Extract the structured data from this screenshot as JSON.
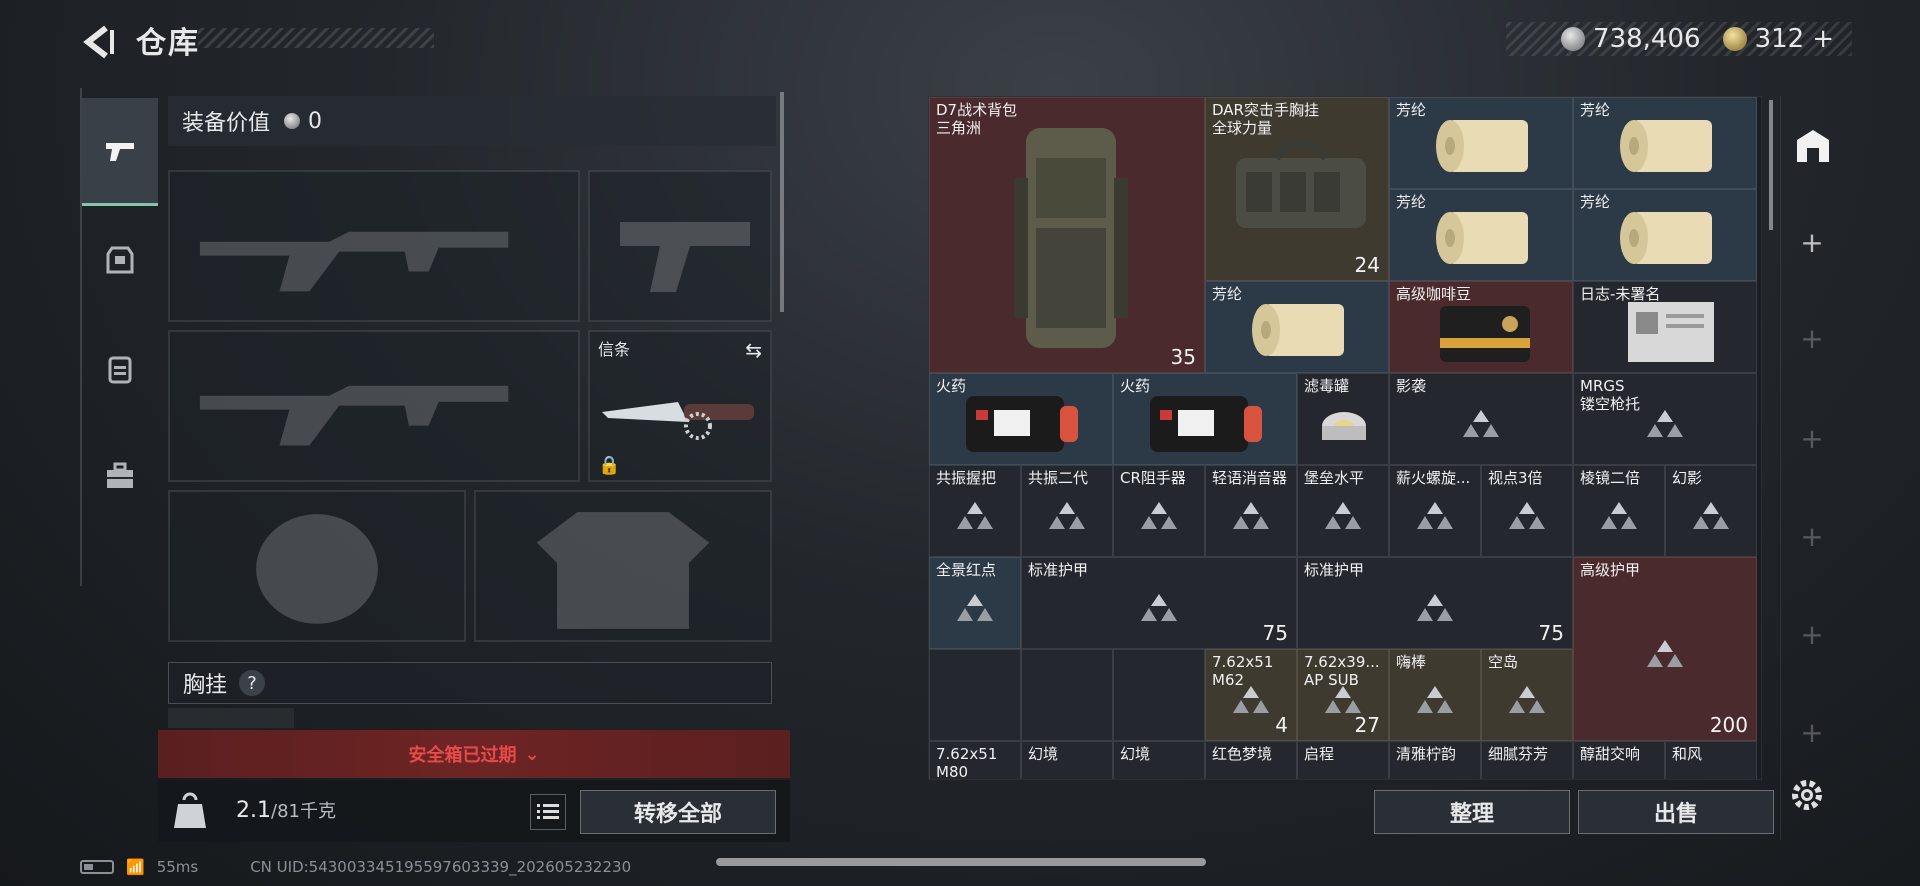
{
  "header": {
    "title": "仓库",
    "currency_silver": "738,406",
    "currency_gold": "312",
    "currency_add": "+"
  },
  "left": {
    "equip_value_label": "装备价值",
    "equip_value": "0",
    "melee_label": "信条",
    "chest_label": "胸挂",
    "chest_help": "?",
    "safe_box": "安全箱已过期",
    "weight_current": "2.1",
    "weight_max": "/81千克",
    "transfer_all": "转移全部"
  },
  "storage": {
    "cells": [
      {
        "name": "D7战术背包\n三角洲",
        "num": "35"
      },
      {
        "name": "DAR突击手胸挂\n全球力量",
        "num": "24"
      },
      {
        "name": "芳纶"
      },
      {
        "name": "芳纶"
      },
      {
        "name": "芳纶"
      },
      {
        "name": "芳纶"
      },
      {
        "name": "芳纶"
      },
      {
        "name": "高级咖啡豆"
      },
      {
        "name": "日志-未署名"
      },
      {
        "name": "火药"
      },
      {
        "name": "火药"
      },
      {
        "name": "滤毒罐"
      },
      {
        "name": "影袭"
      },
      {
        "name": "MRGS\n镂空枪托"
      },
      {
        "name": "共振握把"
      },
      {
        "name": "共振二代"
      },
      {
        "name": "CR阻手器"
      },
      {
        "name": "轻语消音器"
      },
      {
        "name": "堡垒水平"
      },
      {
        "name": "薪火螺旋..."
      },
      {
        "name": "视点3倍"
      },
      {
        "name": "棱镜二倍"
      },
      {
        "name": "幻影"
      },
      {
        "name": "全景红点"
      },
      {
        "name": "标准护甲",
        "num": "75"
      },
      {
        "name": "标准护甲",
        "num": "75"
      },
      {
        "name": "高级护甲",
        "num": "200"
      },
      {
        "name": "7.62x51\nM62",
        "num": "4"
      },
      {
        "name": "7.62x39...\nAP SUB",
        "num": "27"
      },
      {
        "name": "嗨棒"
      },
      {
        "name": "空岛"
      },
      {
        "name": "7.62x51\nM80"
      },
      {
        "name": "幻境"
      },
      {
        "name": "幻境"
      },
      {
        "name": "红色梦境"
      },
      {
        "name": "启程"
      },
      {
        "name": "清雅柠韵"
      },
      {
        "name": "细腻芬芳"
      },
      {
        "name": "醇甜交响"
      },
      {
        "name": "和风"
      }
    ],
    "sort_label": "整理",
    "sell_label": "出售"
  },
  "status": {
    "ping": "55ms",
    "uid": "CN UID:543003345195597603339_202605232230"
  },
  "colors": {
    "accent_green": "#7fc8a7",
    "warning_red": "#e84a4a",
    "rare_red": "#4a2a2d",
    "rare_blue": "#2c3a48",
    "rare_gold": "#3f3a30"
  }
}
